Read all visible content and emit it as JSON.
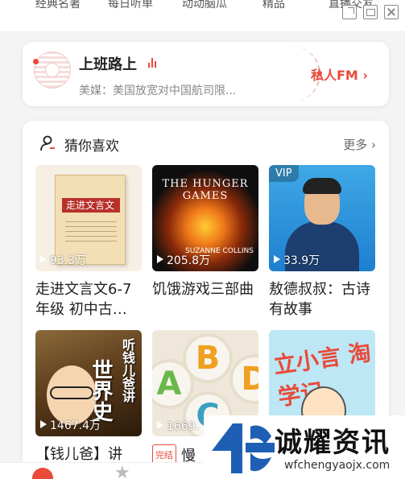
{
  "top_nav": {
    "tabs": [
      "经典名著",
      "每日听单",
      "动动脑瓜",
      "精品",
      "直播交友"
    ]
  },
  "radio": {
    "title": "上班路上",
    "subtitle": "美媒：美国放宽对中国航司限...",
    "fm_label": "私人FM ›"
  },
  "recommend": {
    "title": "猜你喜欢",
    "more_label": "更多 ›",
    "items": [
      {
        "title": "走进文言文6-7年级 初中古…",
        "plays": "93.3万",
        "cover_text": "走进文言文"
      },
      {
        "title": "饥饿游戏三部曲",
        "plays": "205.8万",
        "cover_text": "THE HUNGER GAMES",
        "cover_author": "SUZANNE COLLINS"
      },
      {
        "title": "敖德叔叔：古诗有故事",
        "plays": "33.9万",
        "badge": "VIP"
      },
      {
        "title": "【钱儿爸】讲",
        "plays": "1467.4万",
        "cover_text_top": "听钱儿爸讲",
        "cover_text_main": "世界史"
      },
      {
        "title": "慢",
        "plays": "1669.",
        "tag": "完结",
        "cover_letters": [
          "A",
          "B",
          "C",
          "D"
        ]
      },
      {
        "title": "",
        "plays": "",
        "cover_text": "立小言 淘学记"
      }
    ]
  },
  "watermark": {
    "name": "诚耀资讯",
    "url": "wfchengyaojx.com"
  },
  "colors": {
    "accent": "#e94a3a"
  }
}
